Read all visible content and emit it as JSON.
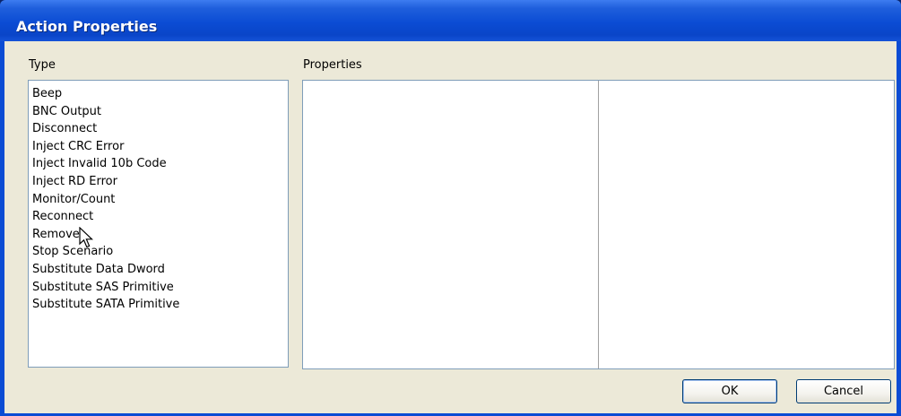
{
  "window": {
    "title": "Action Properties"
  },
  "type_panel": {
    "label": "Type",
    "items": [
      "Beep",
      "BNC Output",
      "Disconnect",
      "Inject CRC Error",
      "Inject Invalid 10b Code",
      "Inject RD Error",
      "Monitor/Count",
      "Reconnect",
      "Remove",
      "Stop Scenario",
      "Substitute Data Dword",
      "Substitute SAS Primitive",
      "Substitute SATA Primitive"
    ]
  },
  "properties_panel": {
    "label": "Properties"
  },
  "buttons": {
    "ok": "OK",
    "cancel": "Cancel"
  },
  "icons": {
    "cursor": "arrow-cursor-icon"
  },
  "colors": {
    "titlebar": "#0b4cd4",
    "dialog_bg": "#ece9d8",
    "field_border": "#7f9db9"
  }
}
